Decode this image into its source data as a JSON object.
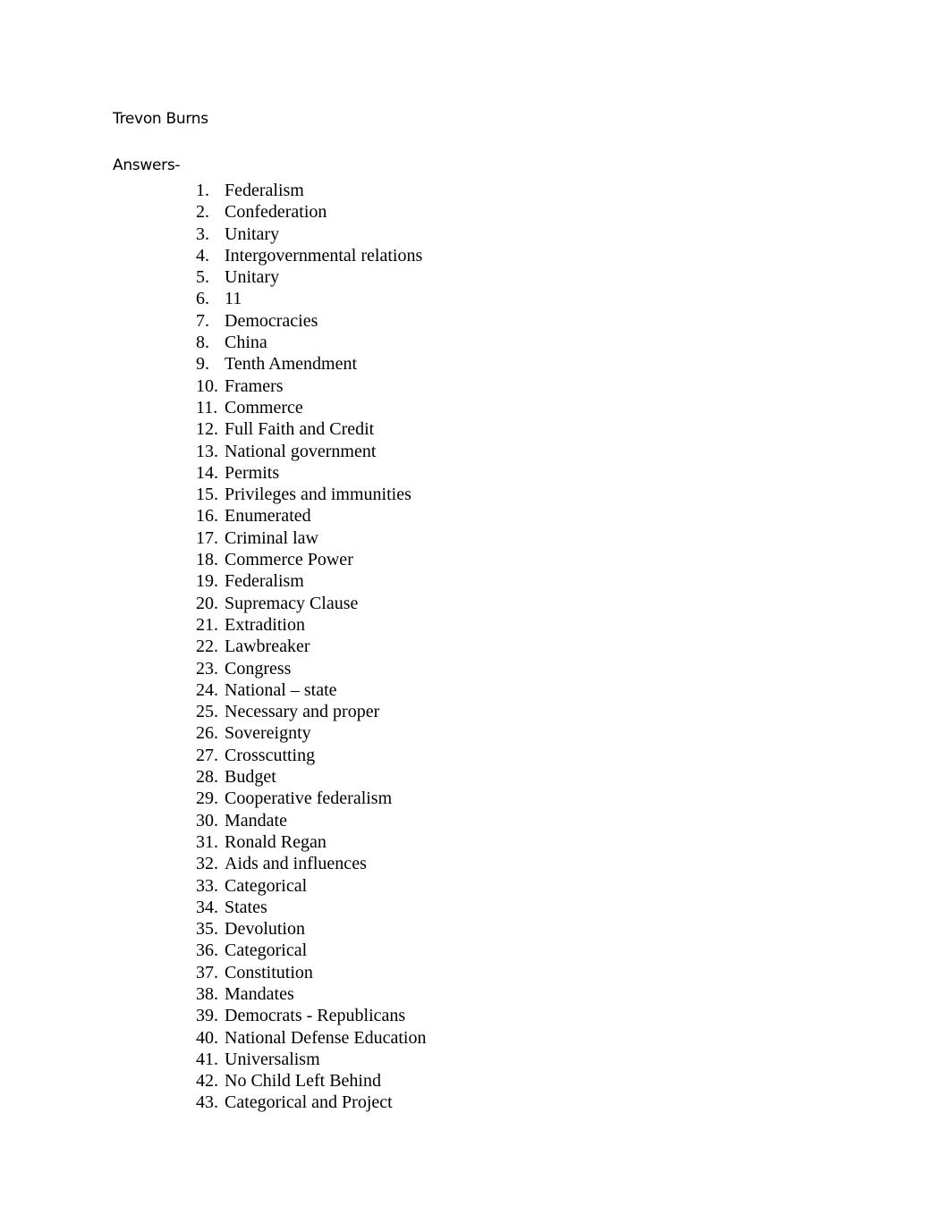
{
  "document": {
    "author": "Trevon Burns",
    "answers_label": "Answers-",
    "answers": [
      {
        "number": "1.",
        "text": "Federalism"
      },
      {
        "number": "2.",
        "text": "Confederation"
      },
      {
        "number": "3.",
        "text": "Unitary"
      },
      {
        "number": "4.",
        "text": "Intergovernmental relations"
      },
      {
        "number": "5.",
        "text": "Unitary"
      },
      {
        "number": "6.",
        "text": "11"
      },
      {
        "number": "7.",
        "text": "Democracies"
      },
      {
        "number": "8.",
        "text": "China"
      },
      {
        "number": "9.",
        "text": "Tenth Amendment"
      },
      {
        "number": "10.",
        "text": "Framers"
      },
      {
        "number": "11.",
        "text": "Commerce"
      },
      {
        "number": "12.",
        "text": "Full Faith and Credit"
      },
      {
        "number": "13.",
        "text": "National government"
      },
      {
        "number": "14.",
        "text": "Permits"
      },
      {
        "number": "15.",
        "text": "Privileges and immunities"
      },
      {
        "number": "16.",
        "text": "Enumerated"
      },
      {
        "number": "17.",
        "text": "Criminal law"
      },
      {
        "number": "18.",
        "text": "Commerce Power"
      },
      {
        "number": "19.",
        "text": "Federalism"
      },
      {
        "number": "20.",
        "text": "Supremacy Clause"
      },
      {
        "number": "21.",
        "text": "Extradition"
      },
      {
        "number": "22.",
        "text": "Lawbreaker"
      },
      {
        "number": "23.",
        "text": "Congress"
      },
      {
        "number": "24.",
        "text": "National – state"
      },
      {
        "number": "25.",
        "text": "Necessary and proper"
      },
      {
        "number": "26.",
        "text": "Sovereignty"
      },
      {
        "number": "27.",
        "text": "Crosscutting"
      },
      {
        "number": "28.",
        "text": "Budget"
      },
      {
        "number": "29.",
        "text": "Cooperative federalism"
      },
      {
        "number": "30.",
        "text": "Mandate"
      },
      {
        "number": "31.",
        "text": "Ronald Regan"
      },
      {
        "number": "32.",
        "text": "Aids and influences"
      },
      {
        "number": "33.",
        "text": "Categorical"
      },
      {
        "number": "34.",
        "text": "States"
      },
      {
        "number": "35.",
        "text": "Devolution"
      },
      {
        "number": "36.",
        "text": "Categorical"
      },
      {
        "number": "37.",
        "text": "Constitution"
      },
      {
        "number": "38.",
        "text": "Mandates"
      },
      {
        "number": "39.",
        "text": "Democrats - Republicans"
      },
      {
        "number": "40.",
        "text": "National Defense Education"
      },
      {
        "number": "41.",
        "text": "Universalism"
      },
      {
        "number": "42.",
        "text": "No Child Left Behind"
      },
      {
        "number": "43.",
        "text": "Categorical and Project"
      }
    ]
  }
}
